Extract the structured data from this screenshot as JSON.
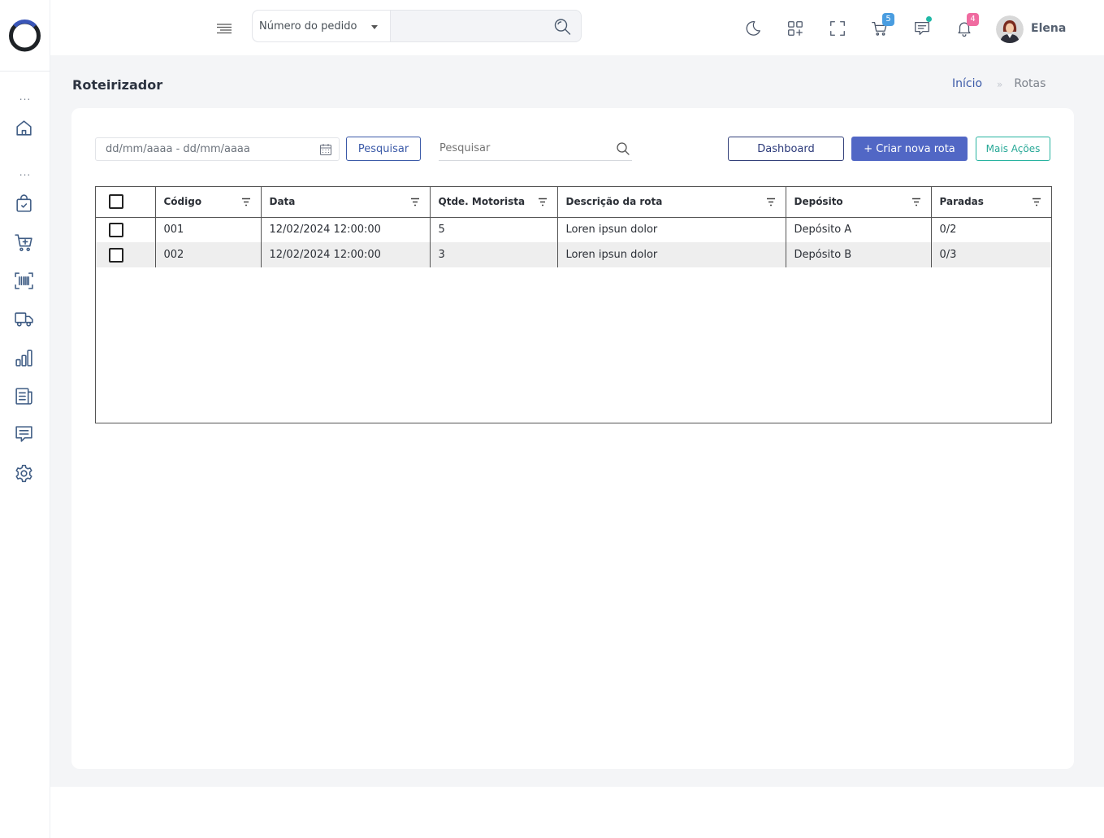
{
  "header": {
    "search_select_label": "Número do pedido",
    "search_value": "",
    "cart_badge": "5",
    "notification_badge": "4",
    "user_name": "Elena",
    "colors": {
      "cart_badge": "#4a9de0",
      "notification_badge": "#f06ba0",
      "message_dot": "#1fb8a6"
    }
  },
  "page": {
    "title": "Roteirizador",
    "breadcrumb": {
      "home": "Início",
      "separator": "»",
      "current": "Rotas"
    }
  },
  "toolbar": {
    "date_range_placeholder": "dd/mm/aaaa - dd/mm/aaaa",
    "pesquisar_label": "Pesquisar",
    "search_placeholder": "Pesquisar",
    "dashboard_label": "Dashboard",
    "create_label": "+ Criar nova rota",
    "more_label": "Mais Ações"
  },
  "table": {
    "columns": [
      "Código",
      "Data",
      "Qtde. Motorista",
      "Descrição da rota",
      "Depósito",
      "Paradas"
    ],
    "rows": [
      [
        "001",
        "12/02/2024 12:00:00",
        "5",
        "Loren ipsun dolor",
        "Depósito A",
        "0/2"
      ],
      [
        "002",
        "12/02/2024 12:00:00",
        "3",
        "Loren ipsun dolor",
        "Depósito B",
        "0/3"
      ]
    ]
  },
  "sidebar": {
    "section_dots": "...",
    "items": [
      "home-icon",
      "shopping-bag-check-icon",
      "cart-add-icon",
      "barcode-scan-icon",
      "truck-icon",
      "bar-chart-icon",
      "document-list-icon",
      "chat-icon",
      "settings-icon"
    ]
  },
  "colors": {
    "accent": "#3b5aa8",
    "primary_button": "#5167c5",
    "teal": "#27b3a0"
  }
}
